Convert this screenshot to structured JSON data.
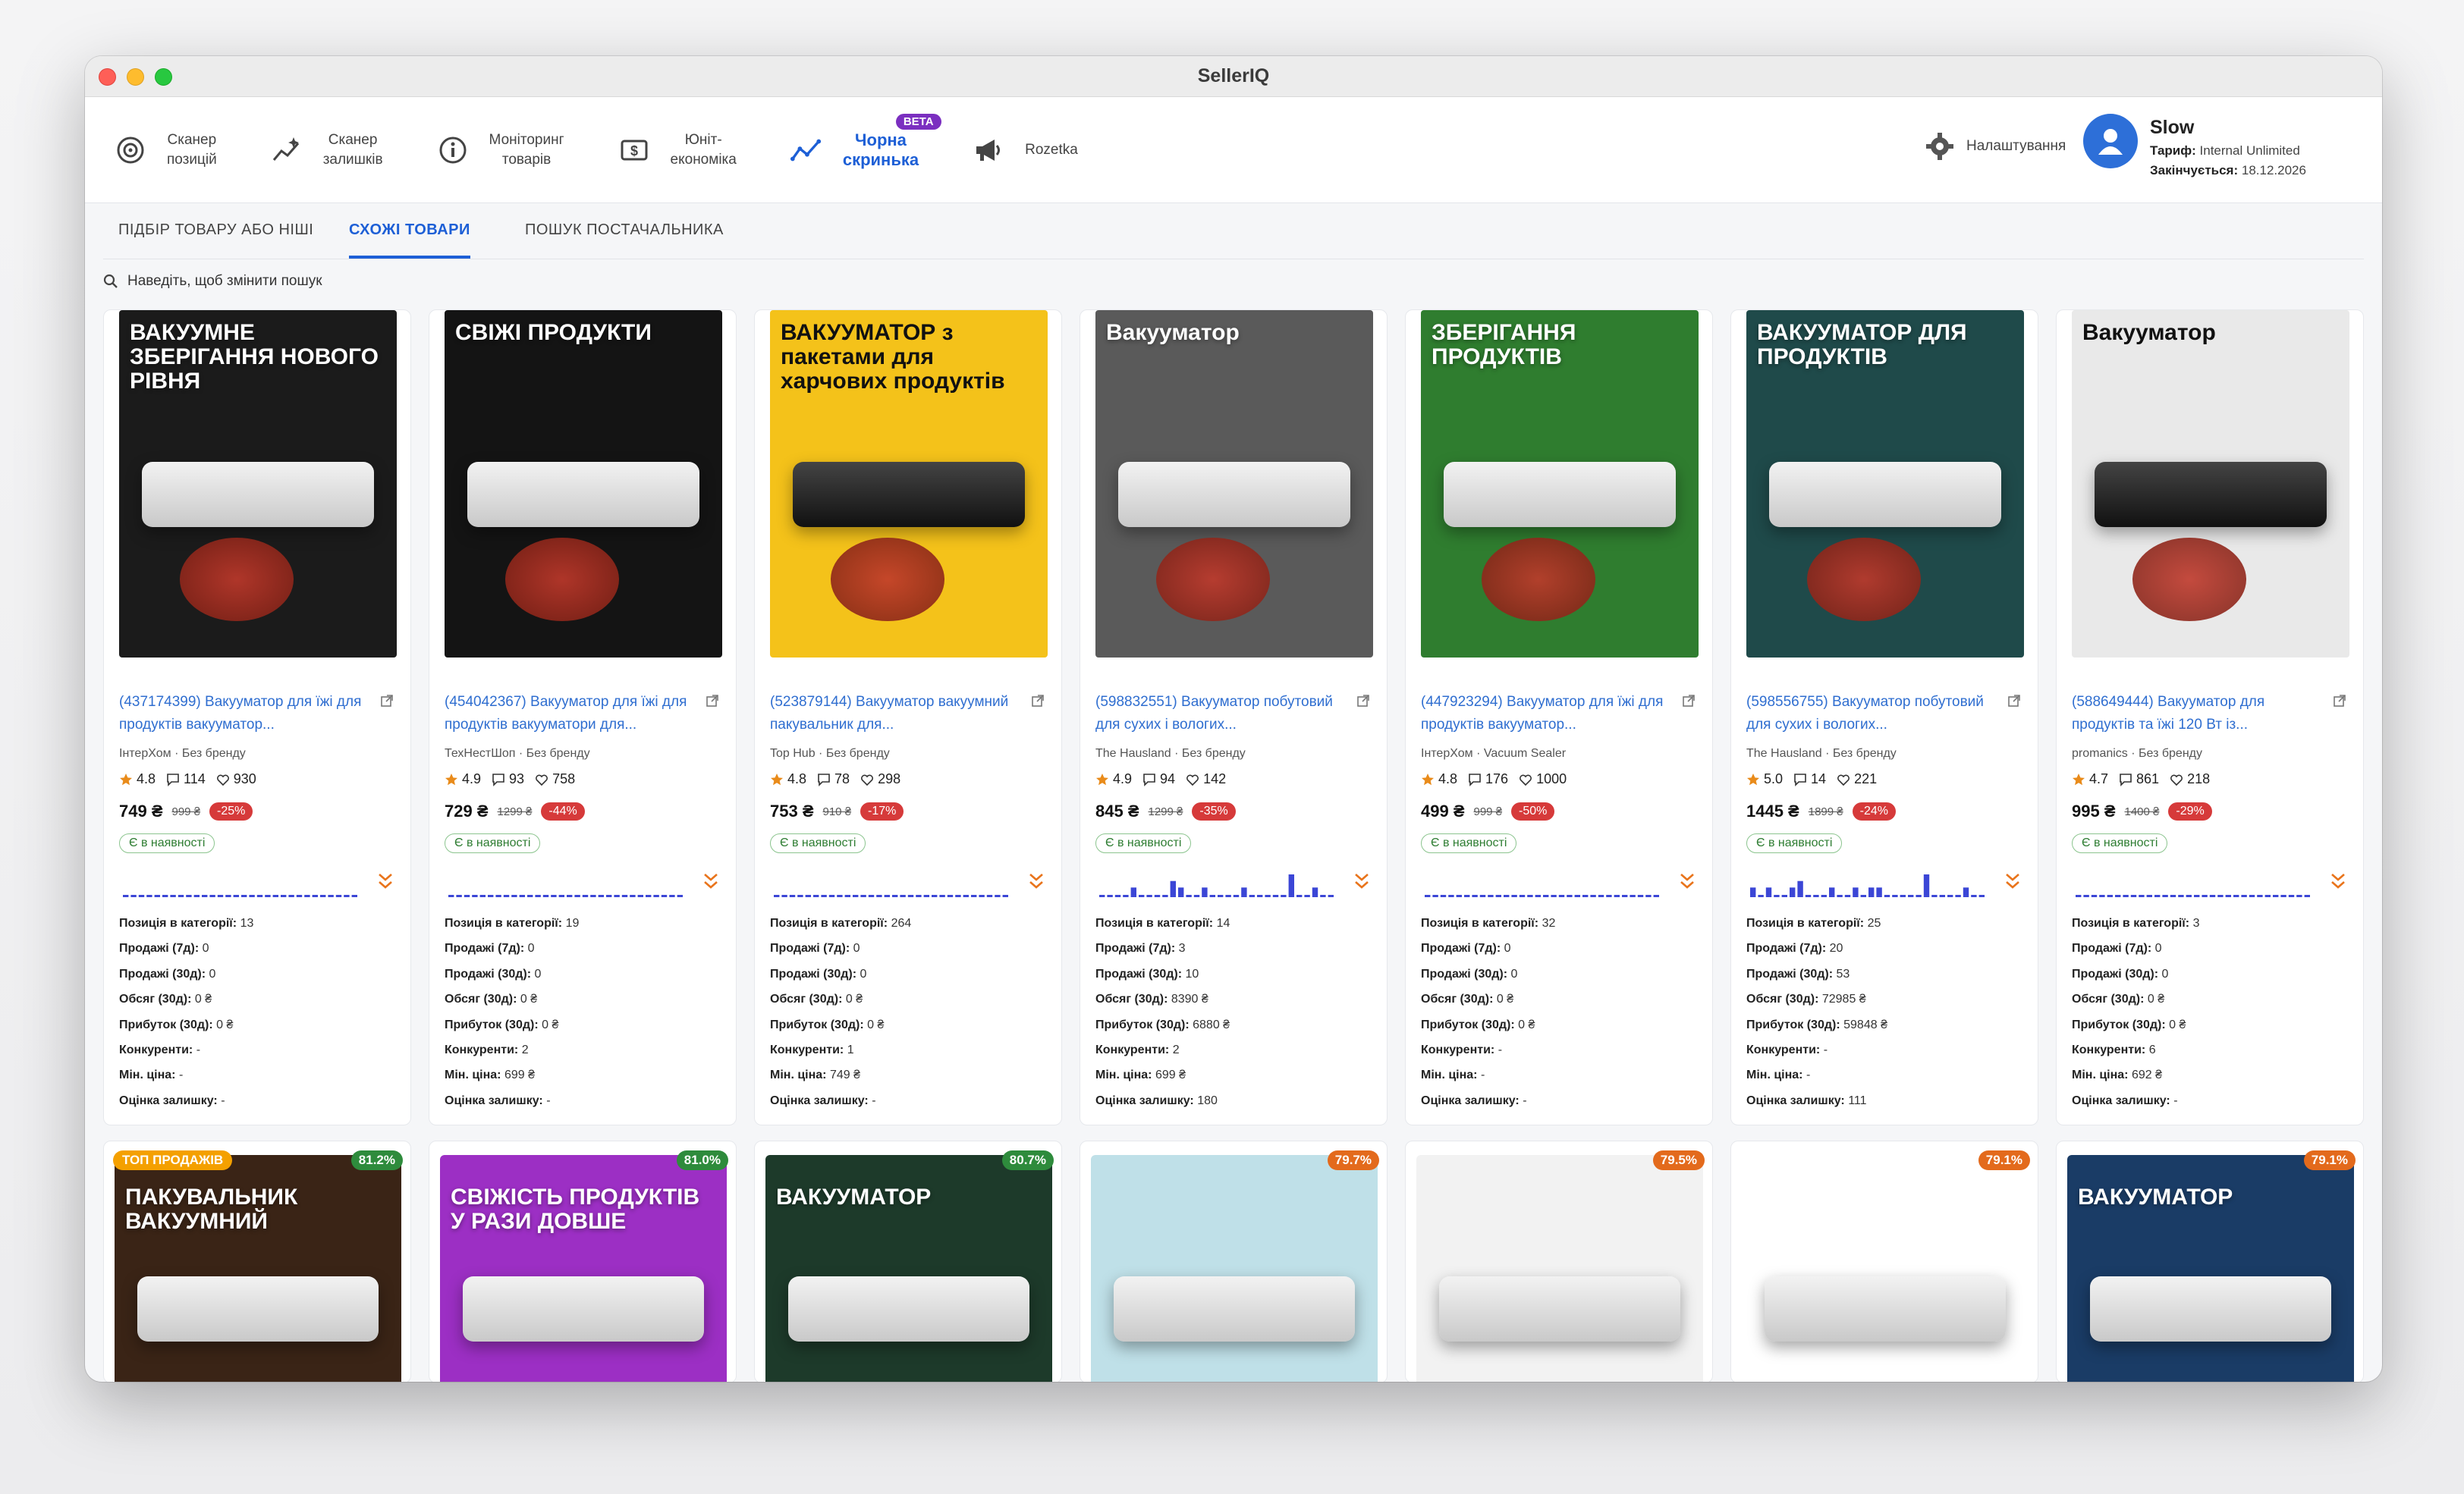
{
  "window": {
    "title": "SellerIQ"
  },
  "nav": {
    "items": [
      {
        "label": "Сканер\nпозицій",
        "icon": "target-icon"
      },
      {
        "label": "Сканер\nзалишків",
        "icon": "sparkle-scan-icon"
      },
      {
        "label": "Моніторинг\nтоварів",
        "icon": "info-icon"
      },
      {
        "label": "Юніт-\nекономіка",
        "icon": "dollar-icon"
      },
      {
        "label": "Чорна\nскринька",
        "icon": "trend-chart-icon",
        "badge": "BETA"
      },
      {
        "label": "Rozetka",
        "icon": "megaphone-icon"
      }
    ],
    "settings_label": "Налаштування"
  },
  "user": {
    "name": "Slow",
    "plan_label": "Тариф:",
    "plan_value": "Internal Unlimited",
    "expires_label": "Закінчується:",
    "expires_value": "18.12.2026"
  },
  "tabs": [
    "ПІДБІР ТОВАРУ АБО НІШІ",
    "СХОЖІ ТОВАРИ",
    "ПОШУК ПОСТАЧАЛЬНИКА"
  ],
  "search_hint": "Наведіть, щоб змінити пошук",
  "metric_labels": {
    "pos": "Позиція в категорії:",
    "s7": "Продажі (7д):",
    "s30": "Продажі (30д):",
    "vol": "Обсяг (30д):",
    "profit": "Прибуток (30д):",
    "comp": "Конкуренти:",
    "min": "Мін. ціна:",
    "stock": "Оцінка залишку:"
  },
  "products": [
    {
      "img_text": "ВАКУУМНЕ ЗБЕРІГАННЯ НОВОГО РІВНЯ",
      "bg": "#1b1b1b",
      "dark": false,
      "title": "(437174399) Вакууматор для їжі для продуктів вакууматор...",
      "seller": "ІнтерХом · Без бренду",
      "rating": "4.8",
      "reviews": "114",
      "likes": "930",
      "price": "749 ₴",
      "old": "999 ₴",
      "disc": "-25%",
      "avail": "Є в наявності",
      "spark": [
        0,
        0,
        0,
        0,
        0,
        0,
        0,
        0,
        0,
        0,
        0,
        0,
        0,
        0,
        0,
        0,
        0,
        0,
        0,
        0,
        0,
        0,
        0,
        0,
        0,
        0,
        0,
        0,
        0,
        0
      ],
      "m": {
        "pos": "13",
        "s7": "0",
        "s30": "0",
        "vol": "0 ₴",
        "profit": "0 ₴",
        "comp": "-",
        "min": "-",
        "stock": "-"
      }
    },
    {
      "img_text": "СВІЖІ ПРОДУКТИ",
      "bg": "#141414",
      "dark": false,
      "title": "(454042367) Вакууматор для їжі для продуктів вакууматори для...",
      "seller": "ТехНестШоп · Без бренду",
      "rating": "4.9",
      "reviews": "93",
      "likes": "758",
      "price": "729 ₴",
      "old": "1299 ₴",
      "disc": "-44%",
      "avail": "Є в наявності",
      "spark": [
        0,
        0,
        0,
        0,
        0,
        0,
        0,
        0,
        0,
        0,
        0,
        0,
        0,
        0,
        0,
        0,
        0,
        0,
        0,
        0,
        0,
        0,
        0,
        0,
        0,
        0,
        0,
        0,
        0,
        0
      ],
      "m": {
        "pos": "19",
        "s7": "0",
        "s30": "0",
        "vol": "0 ₴",
        "profit": "0 ₴",
        "comp": "2",
        "min": "699 ₴",
        "stock": "-"
      }
    },
    {
      "img_text": "ВАКУУМАТОР з пакетами для харчових продуктів",
      "bg": "#f4c21a",
      "dark": true,
      "title": "(523879144) Вакууматор вакуумний пакувальник для...",
      "seller": "Top Hub · Без бренду",
      "rating": "4.8",
      "reviews": "78",
      "likes": "298",
      "price": "753 ₴",
      "old": "910 ₴",
      "disc": "-17%",
      "avail": "Є в наявності",
      "spark": [
        0,
        0,
        0,
        0,
        0,
        0,
        0,
        0,
        0,
        0,
        0,
        0,
        0,
        0,
        0,
        0,
        0,
        0,
        0,
        0,
        0,
        0,
        0,
        0,
        0,
        0,
        0,
        0,
        0,
        0
      ],
      "m": {
        "pos": "264",
        "s7": "0",
        "s30": "0",
        "vol": "0 ₴",
        "profit": "0 ₴",
        "comp": "1",
        "min": "749 ₴",
        "stock": "-"
      }
    },
    {
      "img_text": "Вакууматор",
      "bg": "#5a5a5a",
      "dark": false,
      "title": "(598832551) Вакууматор побутовий для сухих і вологих...",
      "seller": "The Hausland · Без бренду",
      "rating": "4.9",
      "reviews": "94",
      "likes": "142",
      "price": "845 ₴",
      "old": "1299 ₴",
      "disc": "-35%",
      "avail": "Є в наявності",
      "spark": [
        0,
        0,
        0,
        0,
        1,
        0,
        0,
        0,
        0,
        2,
        1,
        0,
        0,
        1,
        0,
        0,
        0,
        0,
        1,
        0,
        0,
        0,
        0,
        0,
        3,
        0,
        0,
        1,
        0,
        0
      ],
      "m": {
        "pos": "14",
        "s7": "3",
        "s30": "10",
        "vol": "8390 ₴",
        "profit": "6880 ₴",
        "comp": "2",
        "min": "699 ₴",
        "stock": "180"
      }
    },
    {
      "img_text": "ЗБЕРІГАННЯ ПРОДУКТІВ",
      "bg": "#2f7d2f",
      "dark": false,
      "title": "(447923294) Вакууматор для їжі для продуктів вакууматор...",
      "seller": "ІнтерХом · Vacuum Sealer",
      "rating": "4.8",
      "reviews": "176",
      "likes": "1000",
      "price": "499 ₴",
      "old": "999 ₴",
      "disc": "-50%",
      "avail": "Є в наявності",
      "spark": [
        0,
        0,
        0,
        0,
        0,
        0,
        0,
        0,
        0,
        0,
        0,
        0,
        0,
        0,
        0,
        0,
        0,
        0,
        0,
        0,
        0,
        0,
        0,
        0,
        0,
        0,
        0,
        0,
        0,
        0
      ],
      "m": {
        "pos": "32",
        "s7": "0",
        "s30": "0",
        "vol": "0 ₴",
        "profit": "0 ₴",
        "comp": "-",
        "min": "-",
        "stock": "-"
      }
    },
    {
      "img_text": "ВАКУУМАТОР ДЛЯ ПРОДУКТІВ",
      "bg": "#1f4a4a",
      "dark": false,
      "title": "(598556755) Вакууматор побутовий для сухих і вологих...",
      "seller": "The Hausland · Без бренду",
      "rating": "5.0",
      "reviews": "14",
      "likes": "221",
      "price": "1445 ₴",
      "old": "1899 ₴",
      "disc": "-24%",
      "avail": "Є в наявності",
      "spark": [
        1,
        0,
        1,
        0,
        0,
        1,
        2,
        0,
        0,
        0,
        1,
        0,
        0,
        1,
        0,
        1,
        1,
        0,
        0,
        0,
        0,
        0,
        3,
        0,
        0,
        0,
        0,
        1,
        0,
        0
      ],
      "m": {
        "pos": "25",
        "s7": "20",
        "s30": "53",
        "vol": "72985 ₴",
        "profit": "59848 ₴",
        "comp": "-",
        "min": "-",
        "stock": "111"
      }
    },
    {
      "img_text": "Вакууматор",
      "bg": "#e9e9e9",
      "dark": true,
      "title": "(588649444) Вакууматор для продуктів та їжі 120 Вт із...",
      "seller": "promanics · Без бренду",
      "rating": "4.7",
      "reviews": "861",
      "likes": "218",
      "price": "995 ₴",
      "old": "1400 ₴",
      "disc": "-29%",
      "avail": "Є в наявності",
      "spark": [
        0,
        0,
        0,
        0,
        0,
        0,
        0,
        0,
        0,
        0,
        0,
        0,
        0,
        0,
        0,
        0,
        0,
        0,
        0,
        0,
        0,
        0,
        0,
        0,
        0,
        0,
        0,
        0,
        0,
        0
      ],
      "m": {
        "pos": "3",
        "s7": "0",
        "s30": "0",
        "vol": "0 ₴",
        "profit": "0 ₴",
        "comp": "6",
        "min": "692 ₴",
        "stock": "-"
      }
    }
  ],
  "row2": [
    {
      "match": "81.2%",
      "match_color": "#2e8b3c",
      "top": "ТОП ПРОДАЖІВ",
      "img_text": "ПАКУВАЛЬНИК ВАКУУМНИЙ",
      "bg": "#3a2416"
    },
    {
      "match": "81.0%",
      "match_color": "#2e8b3c",
      "top": "",
      "img_text": "СВІЖІСТЬ ПРОДУКТІВ У РАЗИ ДОВШЕ",
      "bg": "#9c2fc4"
    },
    {
      "match": "80.7%",
      "match_color": "#2e8b3c",
      "top": "",
      "img_text": "ВАКУУМАТОР",
      "bg": "#1d3a2a"
    },
    {
      "match": "79.7%",
      "match_color": "#e36a1c",
      "top": "",
      "img_text": "",
      "bg": "#bfe0e8"
    },
    {
      "match": "79.5%",
      "match_color": "#e36a1c",
      "top": "",
      "img_text": "",
      "bg": "#f2f2f2"
    },
    {
      "match": "79.1%",
      "match_color": "#e36a1c",
      "top": "",
      "img_text": "",
      "bg": "#ffffff"
    },
    {
      "match": "79.1%",
      "match_color": "#e36a1c",
      "top": "",
      "img_text": "ВАКУУМАТОР",
      "bg": "#1a3c66"
    }
  ]
}
